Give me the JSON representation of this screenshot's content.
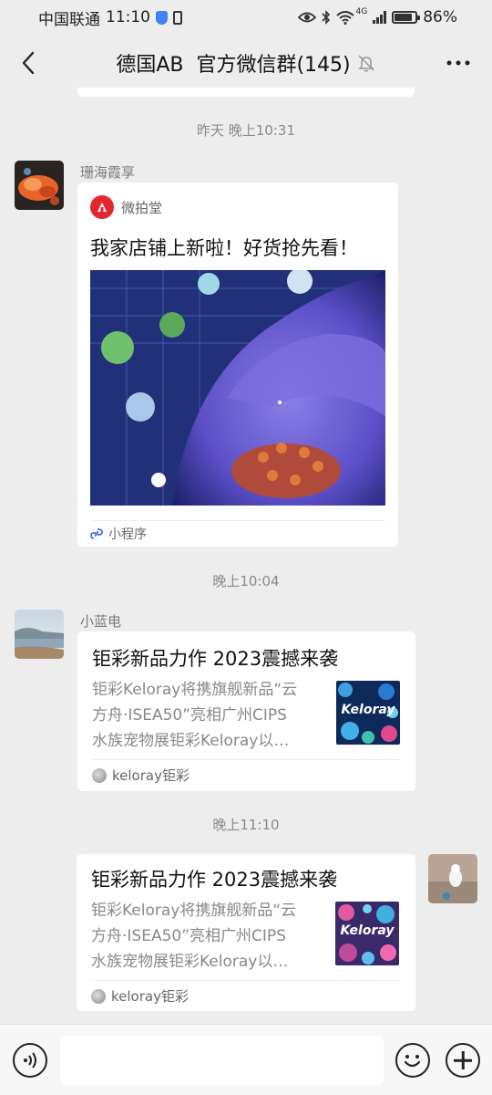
{
  "status_bar": {
    "carrier": "中国联通",
    "time": "11:10",
    "network": "4G",
    "battery": "86%"
  },
  "header": {
    "title": "德国AB  官方微信群(145)",
    "muted_icon": "bell-off-icon",
    "back_icon": "chevron-left-icon",
    "more_icon": "more-dots-icon"
  },
  "messages": [
    {
      "timestamp": "昨天 晚上10:31",
      "sender": "珊海霞享",
      "type": "mini_program",
      "source_name": "微拍堂",
      "title": "我家店铺上新啦！好货抢先看！",
      "footer": "小程序"
    },
    {
      "timestamp": "晚上10:04",
      "sender": "小蓝电",
      "type": "link",
      "title": "钜彩新品力作 2023震撼来袭",
      "desc_lines": [
        "钜彩Keloray将携旗舰新品“云",
        "方舟·ISEA50”亮相广州CIPS",
        "水族宠物展钜彩Keloray以…"
      ],
      "thumb_text": "Keloray",
      "footer": "keloray钜彩"
    },
    {
      "timestamp": "晚上11:10",
      "sender": "",
      "type": "link",
      "title": "钜彩新品力作 2023震撼来袭",
      "desc_lines": [
        "钜彩Keloray将携旗舰新品“云",
        "方舟·ISEA50”亮相广州CIPS",
        "水族宠物展钜彩Keloray以…"
      ],
      "thumb_text": "Keloray",
      "footer": "keloray钜彩"
    }
  ],
  "input_bar": {
    "placeholder": "",
    "voice_icon": "voice-icon",
    "emoji_icon": "emoji-icon",
    "plus_icon": "plus-icon"
  }
}
